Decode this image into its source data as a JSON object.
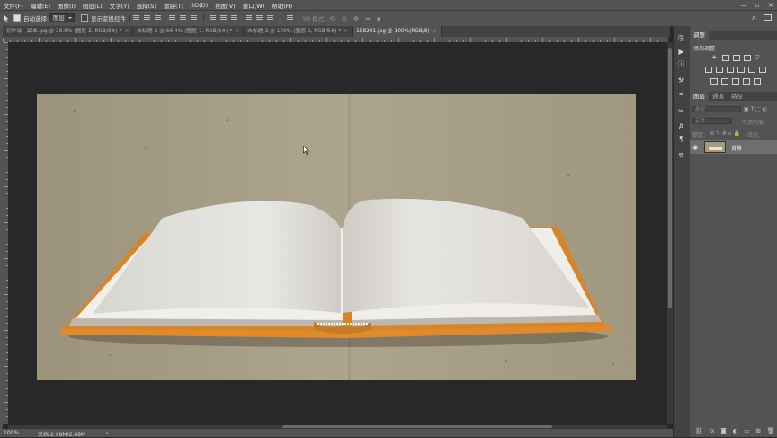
{
  "menubar": {
    "items": [
      "文件(F)",
      "编辑(E)",
      "图像(I)",
      "图层(L)",
      "文字(Y)",
      "选择(S)",
      "滤镜(T)",
      "3D(D)",
      "视图(V)",
      "窗口(W)",
      "帮助(H)"
    ]
  },
  "options": {
    "auto_select_label": "自动选择:",
    "auto_select_value": "图层",
    "show_transform_label": "显示变换控件",
    "mode_3d_label": "3D 模式:"
  },
  "tabs": [
    {
      "label": "初中级 - 副本.jpg @ 28.8% (图层 3, RGB/8#) *",
      "close": "×"
    },
    {
      "label": "未标题-2 @ 66.4% (图层 7, RGB/8#) *",
      "close": "×"
    },
    {
      "label": "未标题-3 @ 100% (图层 2, RGB/8#) *",
      "close": "×"
    },
    {
      "label": "158201.jpg @ 100%(RGB/8)",
      "close": "×"
    }
  ],
  "status": {
    "zoom": "100%",
    "doc_size": "文档:2.68M/2.68M",
    "arrow": "›"
  },
  "panel": {
    "adjust_tab": "调整",
    "add_adjust_label": "添加调整",
    "layer_tabs": [
      "图层",
      "通道",
      "路径"
    ],
    "kind_filter": "类型",
    "blend_mode": "正常",
    "opacity_label": "不透明度:",
    "lock_label": "锁定:",
    "fill_label": "填充:",
    "layer_name": "背景"
  },
  "colors": {
    "chrome": "#535353",
    "dark": "#424242",
    "canvas_bg": "#282828",
    "paper": "#a49b84",
    "book_cover": "#e08a2c",
    "page_white": "#e6e4df"
  }
}
